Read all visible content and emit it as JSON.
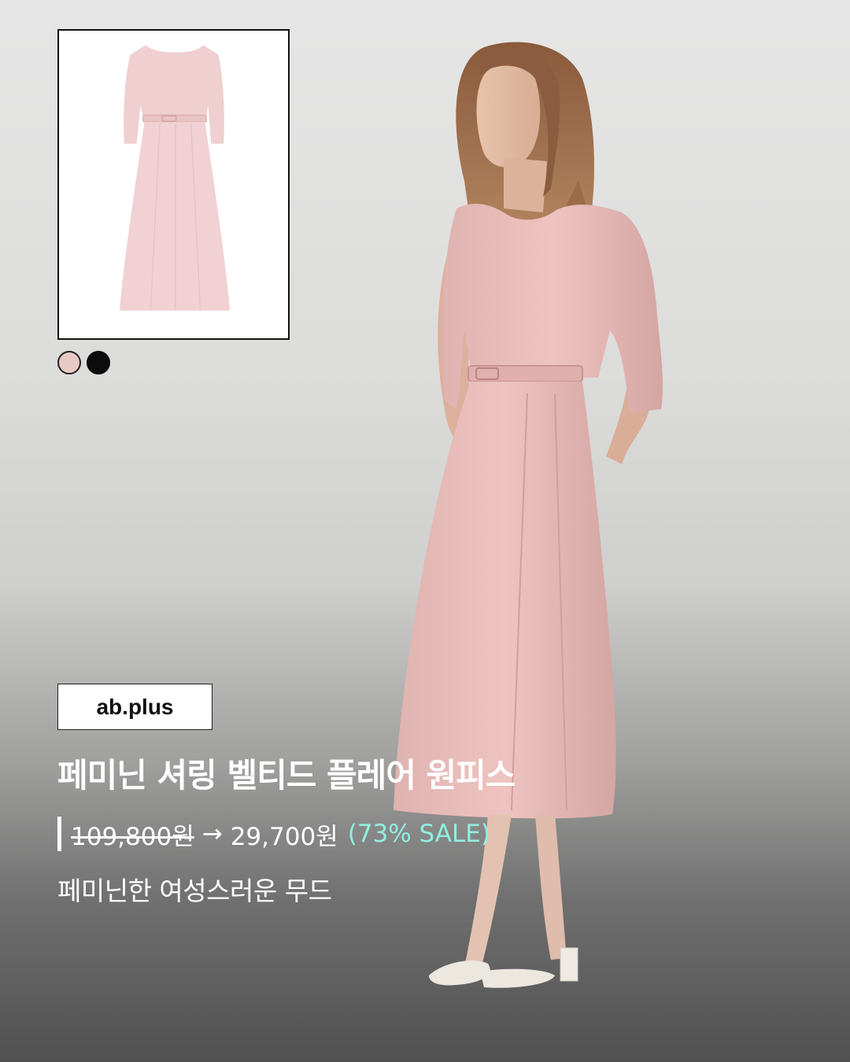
{
  "brand": "ab.plus",
  "product": {
    "title": "페미닌 셔링 벨티드 플레어 원피스",
    "original_price": "109,800원",
    "arrow": "→",
    "sale_price": "29,700원",
    "discount": "(73% SALE)",
    "description": "페미닌한 여성스러운 무드"
  },
  "color_options": [
    {
      "name": "pink",
      "hex": "#e8c9c4"
    },
    {
      "name": "black",
      "hex": "#0c0c0c"
    }
  ],
  "colors": {
    "discount_accent": "#8ff0e0",
    "dress_pink": "#e6b9b6",
    "text": "#ffffff"
  }
}
